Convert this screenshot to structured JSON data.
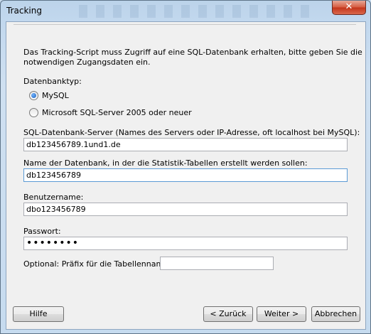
{
  "window": {
    "title": "Tracking",
    "close_symbol": "✕"
  },
  "intro": {
    "line1": "Das Tracking-Script muss Zugriff auf eine SQL-Datenbank erhalten, bitte geben Sie die",
    "line2": "notwendigen Zugangsdaten ein."
  },
  "db_type": {
    "label": "Datenbanktyp:",
    "options": [
      {
        "label": "MySQL",
        "selected": true
      },
      {
        "label": "Microsoft SQL-Server 2005 oder neuer",
        "selected": false
      }
    ]
  },
  "server": {
    "label": "SQL-Datenbank-Server (Names des Servers oder IP-Adresse, oft localhost bei MySQL):",
    "value": "db123456789.1und1.de"
  },
  "database": {
    "label": "Name der Datenbank, in der die Statistik-Tabellen erstellt werden sollen:",
    "value": "db123456789"
  },
  "username": {
    "label": "Benutzername:",
    "value": "dbo123456789"
  },
  "password": {
    "label": "Passwort:",
    "value": "••••••••"
  },
  "prefix": {
    "label": "Optional: Präfix für die Tabellennamen:",
    "value": ""
  },
  "buttons": {
    "help": "Hilfe",
    "back": "< Zurück",
    "next": "Weiter >",
    "cancel": "Abbrechen"
  }
}
